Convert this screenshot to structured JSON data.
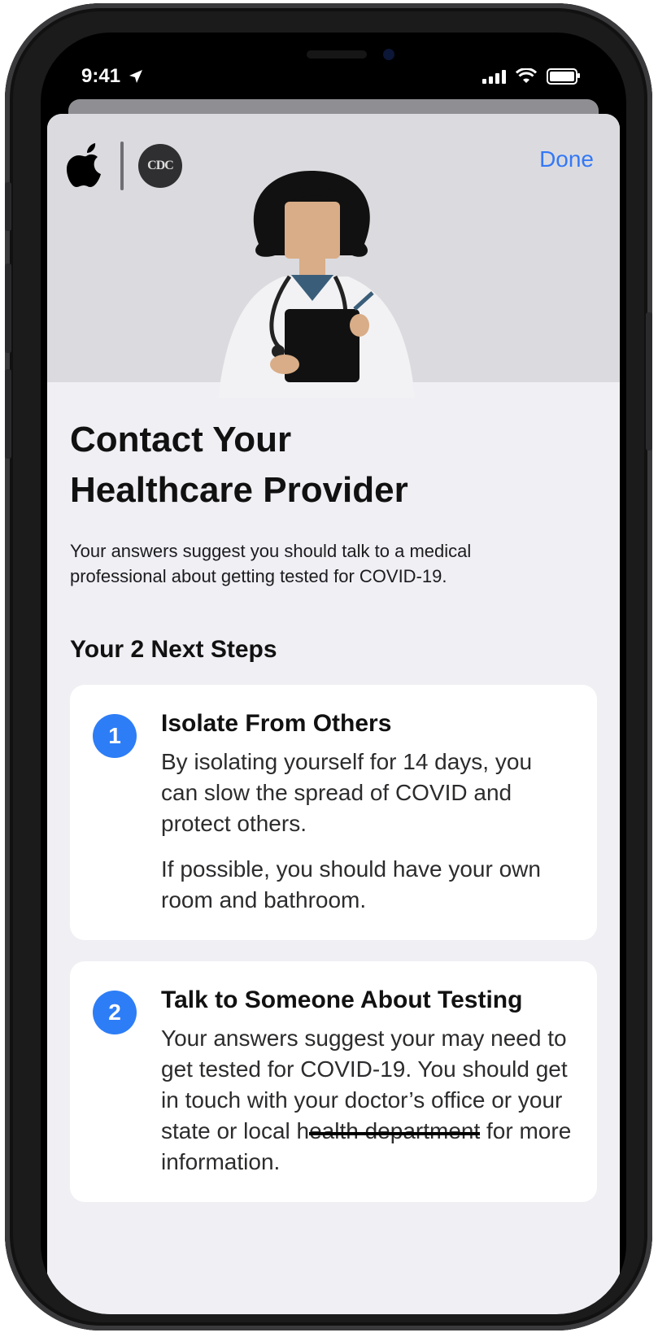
{
  "status_bar": {
    "time": "9:41"
  },
  "header": {
    "apple_logo": "apple-logo",
    "cdc_logo_text": "CDC",
    "done_label": "Done"
  },
  "main": {
    "title_line1": "Contact Your",
    "title_line2": "Healthcare Provider",
    "subtitle": "Your answers suggest you should talk to a medical professional about getting tested for COVID-19.",
    "steps_header": "Your 2 Next Steps"
  },
  "steps": [
    {
      "number": "1",
      "title": "Isolate From Others",
      "paragraphs": [
        "By isolating yourself for 14 days, you can slow the spread of COVID and protect others.",
        "If possible, you should have your own room and bathroom."
      ]
    },
    {
      "number": "2",
      "title": "Talk to Someone About Testing",
      "text_before": "Your answers suggest your may need to get tested for COVID-19. You should get in touch with your doctor’s office or your state or local h",
      "text_struck": "ealth department",
      "text_after": " for more information."
    }
  ],
  "colors": {
    "accent": "#3478f6",
    "step_badge": "#2d7df6",
    "sheet_bg": "#efeff4",
    "hero_bg": "#dbdbdf"
  }
}
